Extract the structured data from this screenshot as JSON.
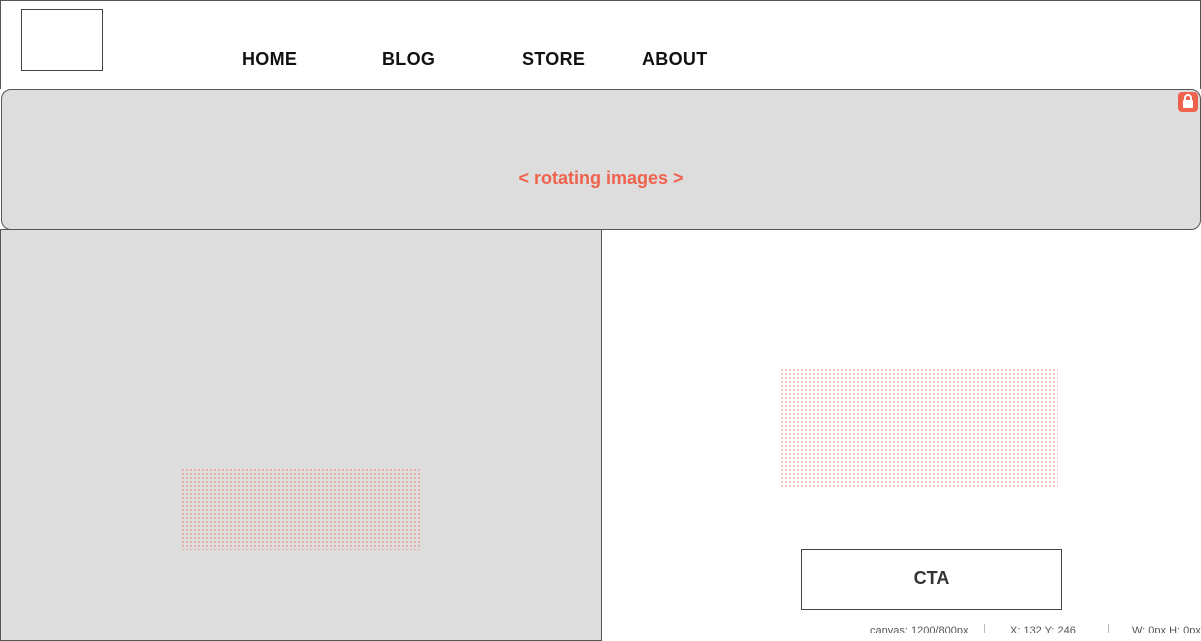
{
  "nav": {
    "items": [
      {
        "label": "HOME"
      },
      {
        "label": "BLOG"
      },
      {
        "label": "STORE"
      },
      {
        "label": "ABOUT"
      }
    ]
  },
  "banner": {
    "text": "< rotating images >",
    "lock_icon": "lock-icon"
  },
  "cta": {
    "label": "CTA"
  },
  "status": {
    "canvas": "canvas: 1200/800px",
    "coords": "X: 132 Y: 246",
    "size": "W: 0px  H: 0px"
  },
  "colors": {
    "accent": "#f0624d",
    "panel_gray": "#dddddd",
    "border": "#555555"
  }
}
